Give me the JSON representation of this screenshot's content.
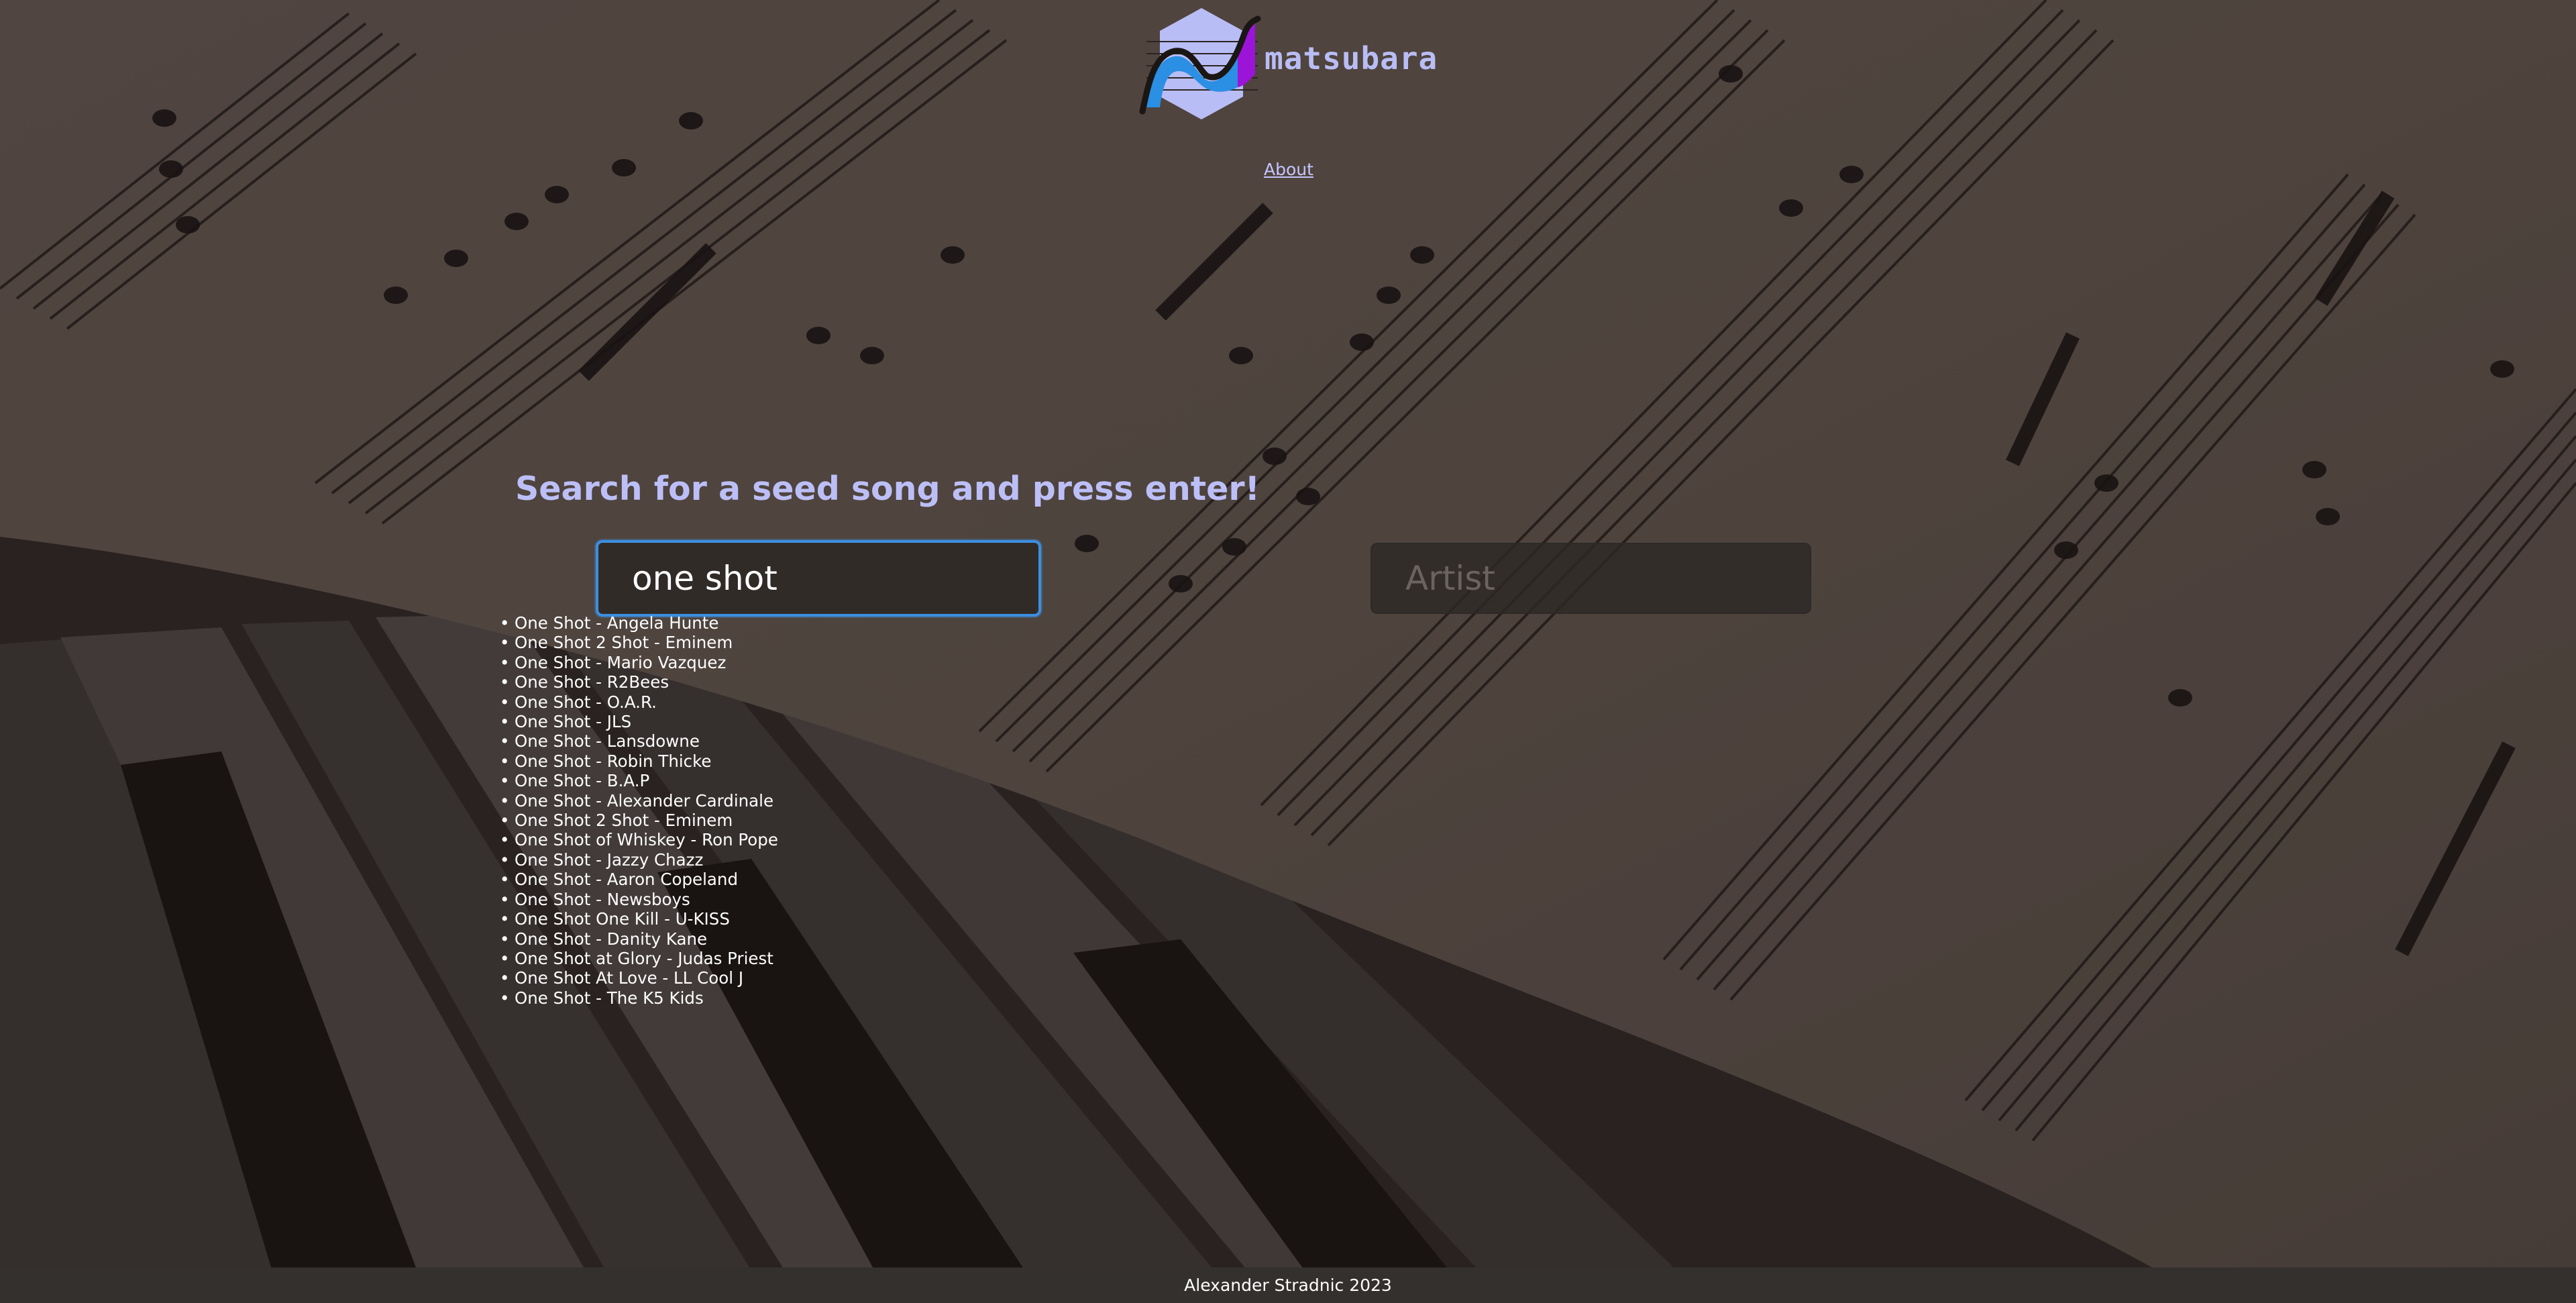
{
  "header": {
    "brand_name": "matsubara",
    "about_link": "About"
  },
  "search": {
    "heading": "Search for a seed song and press enter!",
    "song_input_value": "one shot",
    "artist_placeholder": "Artist"
  },
  "results": [
    "One Shot - Angela Hunte",
    "One Shot 2 Shot - Eminem",
    "One Shot - Mario Vazquez",
    "One Shot - R2Bees",
    "One Shot - O.A.R.",
    "One Shot - JLS",
    "One Shot - Lansdowne",
    "One Shot - Robin Thicke",
    "One Shot - B.A.P",
    "One Shot - Alexander Cardinale",
    "One Shot 2 Shot - Eminem",
    "One Shot of Whiskey - Ron Pope",
    "One Shot - Jazzy Chazz",
    "One Shot - Aaron Copeland",
    "One Shot - Newsboys",
    "One Shot One Kill - U-KISS",
    "One Shot - Danity Kane",
    "One Shot at Glory - Judas Priest",
    "One Shot At Love - LL Cool J",
    "One Shot - The K5 Kids"
  ],
  "footer": {
    "text": "Alexander Stradnic 2023"
  },
  "colors": {
    "accent_text": "#bcbff7",
    "focus_border": "#3d8fe0",
    "logo_purple": "#9b14d8",
    "logo_blue": "#2b8fe3",
    "logo_hex": "#b9bdf5"
  },
  "icons": {
    "logo": "matsubara-logo-icon"
  }
}
